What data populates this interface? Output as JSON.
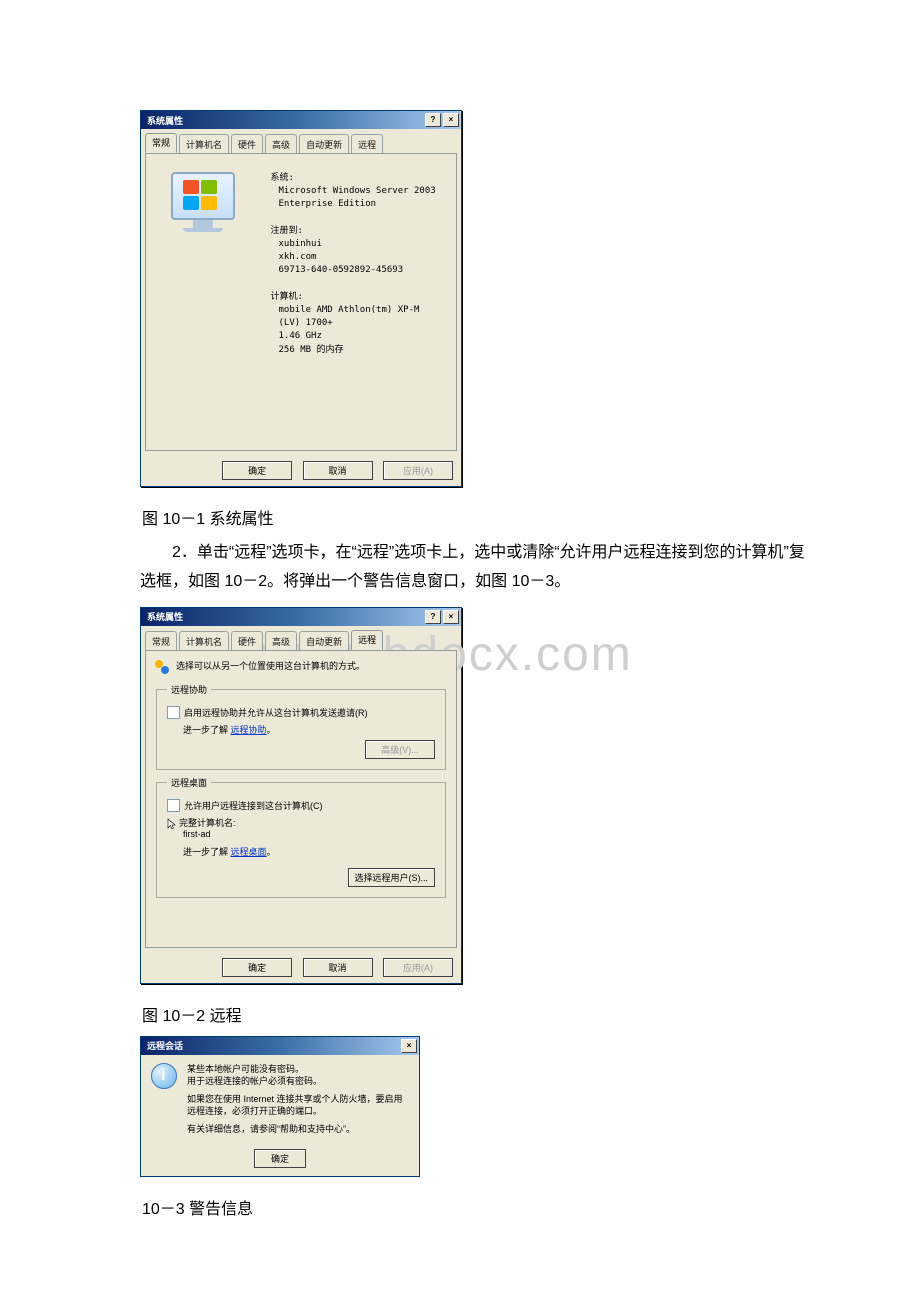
{
  "fig1": {
    "title": "系统属性",
    "tabs": [
      "常规",
      "计算机名",
      "硬件",
      "高级",
      "自动更新",
      "远程"
    ],
    "active_tab": 0,
    "system_hdr": "系统:",
    "system_lines": [
      "Microsoft Windows Server 2003",
      "Enterprise Edition"
    ],
    "reg_hdr": "注册到:",
    "reg_lines": [
      "xubinhui",
      "xkh.com",
      "69713-640-0592892-45693"
    ],
    "computer_hdr": "计算机:",
    "computer_lines": [
      "mobile AMD Athlon(tm) XP-M",
      "(LV) 1700+",
      "1.46 GHz",
      "256 MB 的内存"
    ],
    "ok": "确定",
    "cancel": "取消",
    "apply": "应用(A)"
  },
  "caption1": "图 10－1 系统属性",
  "para1": "2．单击“远程”选项卡，在“远程”选项卡上，选中或清除“允许用户远程连接到您的计算机”复选框，如图 10－2。将弹出一个警告信息窗口，如图 10－3。",
  "fig2": {
    "title": "系统属性",
    "tabs": [
      "常规",
      "计算机名",
      "硬件",
      "高级",
      "自动更新",
      "远程"
    ],
    "active_tab": 5,
    "notice": "选择可以从另一个位置使用这台计算机的方式。",
    "group1_legend": "远程协助",
    "ra_checkbox": "启用远程协助并允许从这台计算机发送邀请(R)",
    "ra_learn_pre": "进一步了解",
    "ra_learn_link": "远程协助",
    "ra_adv_btn": "高级(V)...",
    "group2_legend": "远程桌面",
    "rd_checkbox": "允许用户远程连接到这台计算机(C)",
    "rd_fullname_label": "完整计算机名:",
    "rd_fullname": "first-ad",
    "rd_learn_pre": "进一步了解",
    "rd_learn_link": "远程桌面",
    "rd_select_btn": "选择远程用户(S)...",
    "ok": "确定",
    "cancel": "取消",
    "apply": "应用(A)"
  },
  "caption2": "图 10－2 远程",
  "fig3": {
    "title": "远程会话",
    "line1": "某些本地帐户可能没有密码。",
    "line2": "用于远程连接的帐户必须有密码。",
    "line3": "如果您在使用 Internet 连接共享或个人防火墙，要启用远程连接，必须打开正确的端口。",
    "line4": "有关详细信息，请参阅“帮助和支持中心”。",
    "ok": "确定"
  },
  "caption3": "10－3 警告信息",
  "watermark": "www.bdocx.com"
}
